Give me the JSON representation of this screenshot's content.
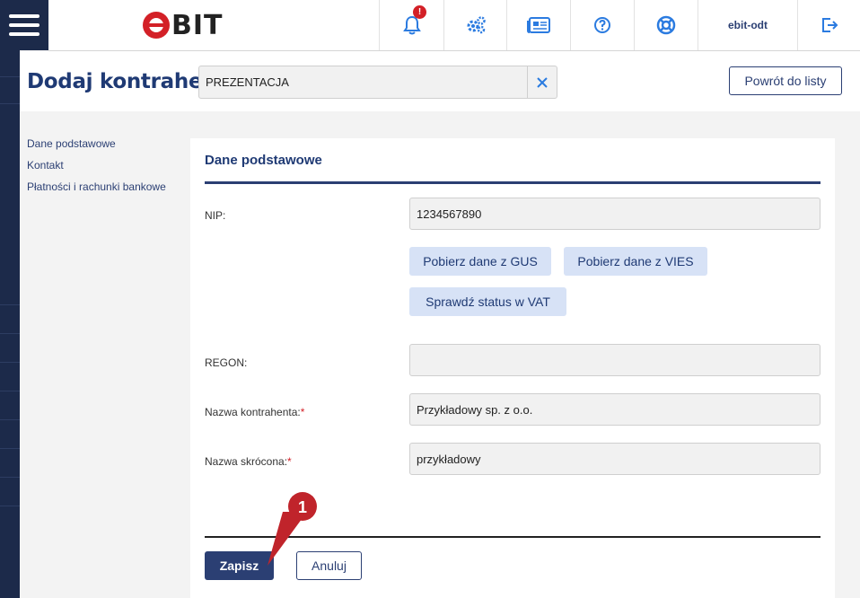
{
  "topbar": {
    "logo_text": "BIT",
    "notification_badge": "!",
    "user": "ebit-odt"
  },
  "header": {
    "title": "Dodaj kontrahenta",
    "company": "PREZENTACJA",
    "back_label": "Powrót do listy"
  },
  "side_nav": {
    "items": [
      "Dane podstawowe",
      "Kontakt",
      "Płatności i rachunki bankowe"
    ]
  },
  "form": {
    "section_title": "Dane podstawowe",
    "nip_label": "NIP:",
    "nip_value": "1234567890",
    "gus_button": "Pobierz dane z GUS",
    "vies_button": "Pobierz dane z VIES",
    "vat_button": "Sprawdź status w VAT",
    "regon_label": "REGON:",
    "regon_value": "",
    "name_label": "Nazwa kontrahenta:",
    "name_value": "Przykładowy sp. z o.o.",
    "short_label": "Nazwa skrócona:",
    "short_value": "przykładowy",
    "required_mark": "*",
    "save_label": "Zapisz",
    "cancel_label": "Anuluj"
  },
  "annotation": {
    "number": "1"
  },
  "colors": {
    "brand_navy": "#2b3f73",
    "brand_red": "#d32027",
    "rail": "#1c2a4a",
    "secondary_button": "#d7e2f6"
  }
}
